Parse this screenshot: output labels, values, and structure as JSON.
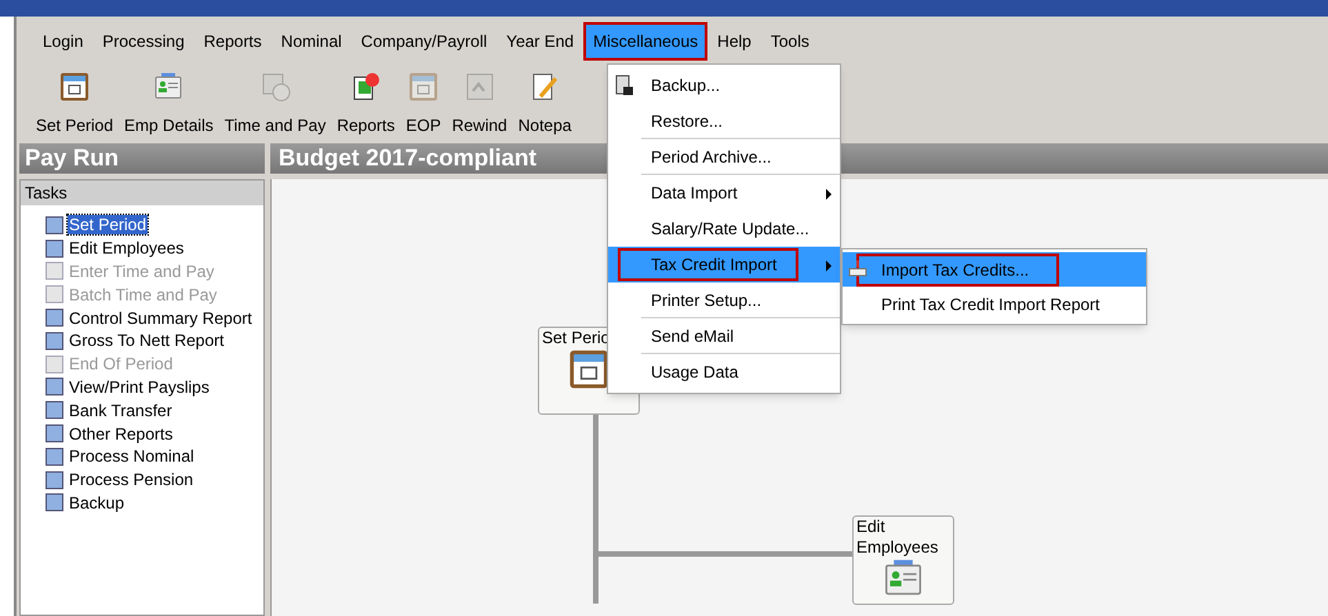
{
  "menubar": [
    {
      "label": "Login",
      "selected": false,
      "callout": false
    },
    {
      "label": "Processing",
      "selected": false,
      "callout": false
    },
    {
      "label": "Reports",
      "selected": false,
      "callout": false
    },
    {
      "label": "Nominal",
      "selected": false,
      "callout": false
    },
    {
      "label": "Company/Payroll",
      "selected": false,
      "callout": false
    },
    {
      "label": "Year End",
      "selected": false,
      "callout": false
    },
    {
      "label": "Miscellaneous",
      "selected": true,
      "callout": true
    },
    {
      "label": "Help",
      "selected": false,
      "callout": false
    },
    {
      "label": "Tools",
      "selected": false,
      "callout": false
    }
  ],
  "toolbar": [
    {
      "label": "Set Period",
      "kind": "calendar",
      "disabled": false
    },
    {
      "label": "Emp Details",
      "kind": "card",
      "disabled": false
    },
    {
      "label": "Time and Pay",
      "kind": "clock",
      "disabled": true
    },
    {
      "label": "Reports",
      "kind": "report",
      "disabled": false
    },
    {
      "label": "EOP",
      "kind": "calendar",
      "disabled": true
    },
    {
      "label": "Rewind",
      "kind": "rewind",
      "disabled": true
    },
    {
      "label": "Notepa",
      "kind": "note",
      "disabled": false
    }
  ],
  "left_panel": {
    "title": "Pay Run",
    "section": "Tasks",
    "tasks": [
      {
        "label": "Set Period",
        "selected": true,
        "disabled": false
      },
      {
        "label": "Edit Employees",
        "selected": false,
        "disabled": false
      },
      {
        "label": "Enter Time and Pay",
        "selected": false,
        "disabled": true
      },
      {
        "label": "Batch Time and Pay",
        "selected": false,
        "disabled": true
      },
      {
        "label": "Control Summary Report",
        "selected": false,
        "disabled": false
      },
      {
        "label": "Gross To Nett Report",
        "selected": false,
        "disabled": false
      },
      {
        "label": "End Of Period",
        "selected": false,
        "disabled": true
      },
      {
        "label": "View/Print Payslips",
        "selected": false,
        "disabled": false
      },
      {
        "label": "Bank Transfer",
        "selected": false,
        "disabled": false
      },
      {
        "label": "Other Reports",
        "selected": false,
        "disabled": false
      },
      {
        "label": "Process Nominal",
        "selected": false,
        "disabled": false
      },
      {
        "label": "Process Pension",
        "selected": false,
        "disabled": false
      },
      {
        "label": "Backup",
        "selected": false,
        "disabled": false
      }
    ]
  },
  "main_panel": {
    "title": "Budget 2017-compliant",
    "nodes": [
      {
        "label": "Set Perio",
        "kind": "calendar"
      },
      {
        "label": "Edit Employees",
        "kind": "card"
      }
    ]
  },
  "dropdown": [
    {
      "label": "Backup...",
      "selected": false,
      "submenu": false,
      "divider_after": false,
      "callout": false,
      "icon": true
    },
    {
      "label": "Restore...",
      "selected": false,
      "submenu": false,
      "divider_after": true,
      "callout": false,
      "icon": false
    },
    {
      "label": "Period Archive...",
      "selected": false,
      "submenu": false,
      "divider_after": true,
      "callout": false,
      "icon": false
    },
    {
      "label": "Data Import",
      "selected": false,
      "submenu": true,
      "divider_after": false,
      "callout": false,
      "icon": false
    },
    {
      "label": "Salary/Rate Update...",
      "selected": false,
      "submenu": false,
      "divider_after": false,
      "callout": false,
      "icon": false
    },
    {
      "label": "Tax Credit Import",
      "selected": true,
      "submenu": true,
      "divider_after": false,
      "callout": true,
      "icon": false
    },
    {
      "label": "Printer Setup...",
      "selected": false,
      "submenu": false,
      "divider_after": true,
      "callout": false,
      "icon": false
    },
    {
      "label": "Send eMail",
      "selected": false,
      "submenu": false,
      "divider_after": true,
      "callout": false,
      "icon": false
    },
    {
      "label": "Usage Data",
      "selected": false,
      "submenu": false,
      "divider_after": false,
      "callout": false,
      "icon": false
    }
  ],
  "submenu": [
    {
      "label": "Import Tax Credits...",
      "selected": true,
      "callout": true,
      "icon": true
    },
    {
      "label": "Print Tax Credit Import Report",
      "selected": false,
      "callout": false,
      "icon": false
    }
  ]
}
